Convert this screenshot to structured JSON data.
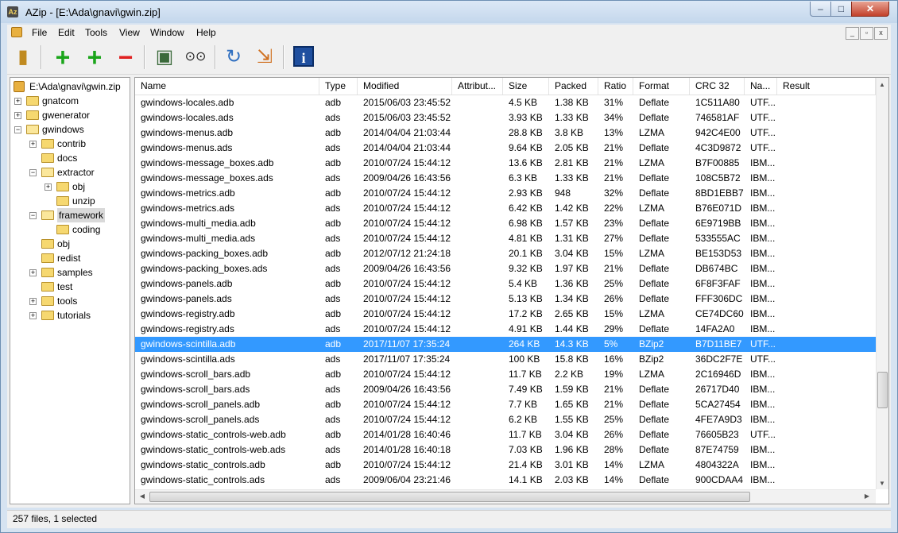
{
  "window": {
    "title": "AZip - [E:\\Ada\\gnavi\\gwin.zip]",
    "app_icon": "azip-app-icon",
    "controls": {
      "minimize": "–",
      "maximize": "□",
      "close": "✕"
    }
  },
  "menu": {
    "items": [
      "File",
      "Edit",
      "Tools",
      "View",
      "Window",
      "Help"
    ],
    "mdi_controls": [
      "_",
      "▫",
      "x"
    ]
  },
  "toolbar": {
    "buttons": [
      {
        "name": "extract-icon",
        "glyph": "▮"
      },
      {
        "name": "add-files-icon",
        "glyph": "+"
      },
      {
        "name": "add-folder-icon",
        "glyph": "+"
      },
      {
        "name": "delete-icon",
        "glyph": "−"
      },
      {
        "name": "test-archive-icon",
        "glyph": "▣"
      },
      {
        "name": "find-icon",
        "glyph": "⊙⊙"
      },
      {
        "name": "update-archive-icon",
        "glyph": "↻"
      },
      {
        "name": "recompress-icon",
        "glyph": "⇲"
      },
      {
        "name": "about-icon",
        "glyph": "i"
      }
    ]
  },
  "tree": {
    "root": "E:\\Ada\\gnavi\\gwin.zip",
    "nodes": [
      {
        "label": "gnatcom",
        "level": 1,
        "expander": "+"
      },
      {
        "label": "gwenerator",
        "level": 1,
        "expander": "+"
      },
      {
        "label": "gwindows",
        "level": 1,
        "expander": "−"
      },
      {
        "label": "contrib",
        "level": 2,
        "expander": "+"
      },
      {
        "label": "docs",
        "level": 2,
        "expander": ""
      },
      {
        "label": "extractor",
        "level": 2,
        "expander": "−"
      },
      {
        "label": "obj",
        "level": 3,
        "expander": "+"
      },
      {
        "label": "unzip",
        "level": 3,
        "expander": ""
      },
      {
        "label": "framework",
        "level": 2,
        "expander": "−",
        "selected": true
      },
      {
        "label": "coding",
        "level": 3,
        "expander": ""
      },
      {
        "label": "obj",
        "level": 2,
        "expander": ""
      },
      {
        "label": "redist",
        "level": 2,
        "expander": ""
      },
      {
        "label": "samples",
        "level": 2,
        "expander": "+"
      },
      {
        "label": "test",
        "level": 2,
        "expander": ""
      },
      {
        "label": "tools",
        "level": 2,
        "expander": "+"
      },
      {
        "label": "tutorials",
        "level": 2,
        "expander": "+"
      }
    ]
  },
  "list": {
    "columns": [
      "Name",
      "Type",
      "Modified",
      "Attribut...",
      "Size",
      "Packed",
      "Ratio",
      "Format",
      "CRC 32",
      "Na...",
      "Result"
    ],
    "rows": [
      [
        "gwindows-locales.adb",
        "adb",
        "2015/06/03  23:45:52",
        "",
        "4.5 KB",
        "1.38 KB",
        "31%",
        "Deflate",
        "1C511A80",
        "UTF..."
      ],
      [
        "gwindows-locales.ads",
        "ads",
        "2015/06/03  23:45:52",
        "",
        "3.93 KB",
        "1.33 KB",
        "34%",
        "Deflate",
        "746581AF",
        "UTF..."
      ],
      [
        "gwindows-menus.adb",
        "adb",
        "2014/04/04  21:03:44",
        "",
        "28.8 KB",
        "3.8 KB",
        "13%",
        "LZMA",
        "942C4E00",
        "UTF..."
      ],
      [
        "gwindows-menus.ads",
        "ads",
        "2014/04/04  21:03:44",
        "",
        "9.64 KB",
        "2.05 KB",
        "21%",
        "Deflate",
        "4C3D9872",
        "UTF..."
      ],
      [
        "gwindows-message_boxes.adb",
        "adb",
        "2010/07/24  15:44:12",
        "",
        "13.6 KB",
        "2.81 KB",
        "21%",
        "LZMA",
        "B7F00885",
        "IBM..."
      ],
      [
        "gwindows-message_boxes.ads",
        "ads",
        "2009/04/26  16:43:56",
        "",
        "6.3 KB",
        "1.33 KB",
        "21%",
        "Deflate",
        "108C5B72",
        "IBM..."
      ],
      [
        "gwindows-metrics.adb",
        "adb",
        "2010/07/24  15:44:12",
        "",
        "2.93 KB",
        "948",
        "32%",
        "Deflate",
        "8BD1EBB7",
        "IBM..."
      ],
      [
        "gwindows-metrics.ads",
        "ads",
        "2010/07/24  15:44:12",
        "",
        "6.42 KB",
        "1.42 KB",
        "22%",
        "LZMA",
        "B76E071D",
        "IBM..."
      ],
      [
        "gwindows-multi_media.adb",
        "adb",
        "2010/07/24  15:44:12",
        "",
        "6.98 KB",
        "1.57 KB",
        "23%",
        "Deflate",
        "6E9719BB",
        "IBM..."
      ],
      [
        "gwindows-multi_media.ads",
        "ads",
        "2010/07/24  15:44:12",
        "",
        "4.81 KB",
        "1.31 KB",
        "27%",
        "Deflate",
        "533555AC",
        "IBM..."
      ],
      [
        "gwindows-packing_boxes.adb",
        "adb",
        "2012/07/12  21:24:18",
        "",
        "20.1 KB",
        "3.04 KB",
        "15%",
        "LZMA",
        "BE153D53",
        "IBM..."
      ],
      [
        "gwindows-packing_boxes.ads",
        "ads",
        "2009/04/26  16:43:56",
        "",
        "9.32 KB",
        "1.97 KB",
        "21%",
        "Deflate",
        "DB674BC",
        "IBM..."
      ],
      [
        "gwindows-panels.adb",
        "adb",
        "2010/07/24  15:44:12",
        "",
        "5.4 KB",
        "1.36 KB",
        "25%",
        "Deflate",
        "6F8F3FAF",
        "IBM..."
      ],
      [
        "gwindows-panels.ads",
        "ads",
        "2010/07/24  15:44:12",
        "",
        "5.13 KB",
        "1.34 KB",
        "26%",
        "Deflate",
        "FFF306DC",
        "IBM..."
      ],
      [
        "gwindows-registry.adb",
        "adb",
        "2010/07/24  15:44:12",
        "",
        "17.2 KB",
        "2.65 KB",
        "15%",
        "LZMA",
        "CE74DC60",
        "IBM..."
      ],
      [
        "gwindows-registry.ads",
        "ads",
        "2010/07/24  15:44:12",
        "",
        "4.91 KB",
        "1.44 KB",
        "29%",
        "Deflate",
        "14FA2A0",
        "IBM..."
      ],
      [
        "gwindows-scintilla.adb",
        "adb",
        "2017/11/07  17:35:24",
        "",
        "264 KB",
        "14.3 KB",
        "5%",
        "BZip2",
        "B7D11BE7",
        "UTF..."
      ],
      [
        "gwindows-scintilla.ads",
        "ads",
        "2017/11/07  17:35:24",
        "",
        "100 KB",
        "15.8 KB",
        "16%",
        "BZip2",
        "36DC2F7E",
        "UTF..."
      ],
      [
        "gwindows-scroll_bars.adb",
        "adb",
        "2010/07/24  15:44:12",
        "",
        "11.7 KB",
        "2.2 KB",
        "19%",
        "LZMA",
        "2C16946D",
        "IBM..."
      ],
      [
        "gwindows-scroll_bars.ads",
        "ads",
        "2009/04/26  16:43:56",
        "",
        "7.49 KB",
        "1.59 KB",
        "21%",
        "Deflate",
        "26717D40",
        "IBM..."
      ],
      [
        "gwindows-scroll_panels.adb",
        "adb",
        "2010/07/24  15:44:12",
        "",
        "7.7 KB",
        "1.65 KB",
        "21%",
        "Deflate",
        "5CA27454",
        "IBM..."
      ],
      [
        "gwindows-scroll_panels.ads",
        "ads",
        "2010/07/24  15:44:12",
        "",
        "6.2 KB",
        "1.55 KB",
        "25%",
        "Deflate",
        "4FE7A9D3",
        "IBM..."
      ],
      [
        "gwindows-static_controls-web.adb",
        "adb",
        "2014/01/28  16:40:46",
        "",
        "11.7 KB",
        "3.04 KB",
        "26%",
        "Deflate",
        "76605B23",
        "UTF..."
      ],
      [
        "gwindows-static_controls-web.ads",
        "ads",
        "2014/01/28  16:40:18",
        "",
        "7.03 KB",
        "1.96 KB",
        "28%",
        "Deflate",
        "87E74759",
        "IBM..."
      ],
      [
        "gwindows-static_controls.adb",
        "adb",
        "2010/07/24  15:44:12",
        "",
        "21.4 KB",
        "3.01 KB",
        "14%",
        "LZMA",
        "4804322A",
        "IBM..."
      ],
      [
        "gwindows-static_controls.ads",
        "ads",
        "2009/06/04  23:21:46",
        "",
        "14.1 KB",
        "2.03 KB",
        "14%",
        "Deflate",
        "900CDAA4",
        "IBM..."
      ]
    ],
    "selected_index": 16,
    "selection_color": "#3399ff"
  },
  "scroll": {
    "up": "▲",
    "down": "▼",
    "left": "◀",
    "right": "▶"
  },
  "status": {
    "text": "257 files, 1 selected"
  }
}
